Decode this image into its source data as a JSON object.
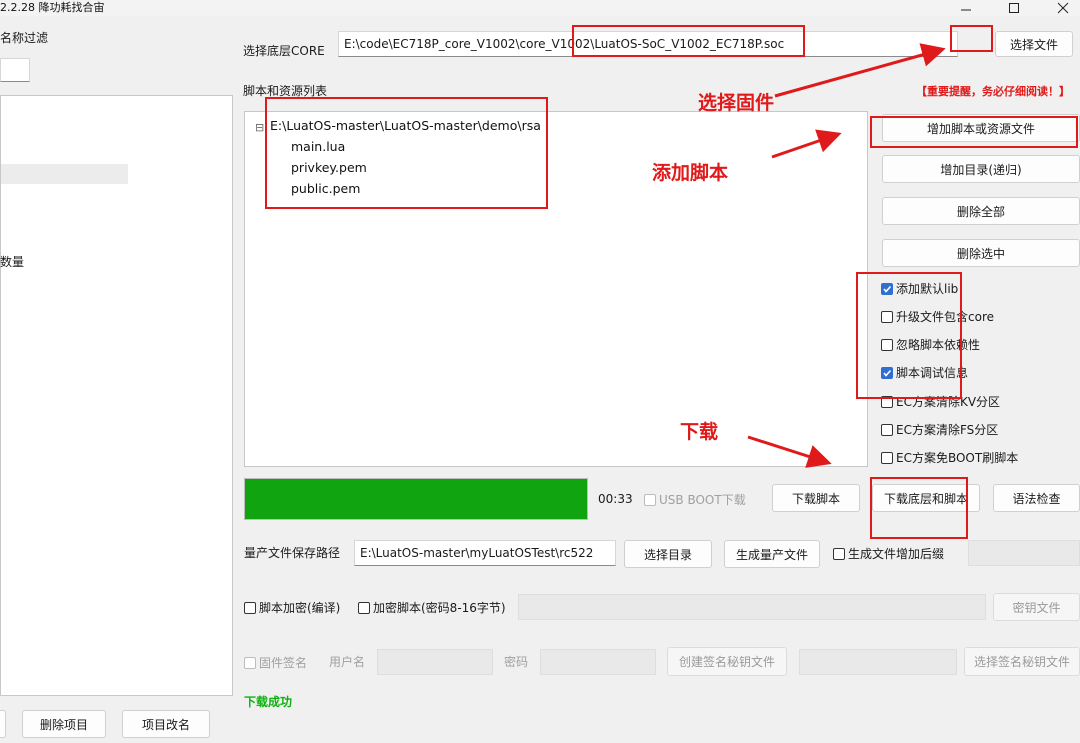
{
  "window": {
    "title": "2.2.28 降功耗找合宙",
    "minimize_icon": "minimize-icon",
    "maximize_icon": "maximize-icon",
    "close_icon": "close-icon"
  },
  "left_panel": {
    "filter_label": "名称过滤",
    "filter_value": "",
    "count_label": "数量",
    "delete_project_button": "删除项目",
    "rename_project_button": "项目改名"
  },
  "core": {
    "label": "选择底层CORE",
    "path": "E:\\code\\EC718P_core_V1002\\core_V1002\\LuatOS-SoC_V1002_EC718P.soc",
    "select_file_button": "选择文件"
  },
  "reminder_text": "【重要提醒，务必仔细阅读！】",
  "scripts": {
    "list_label": "脚本和资源列表",
    "tree_toggle": "⊟",
    "root": "E:\\LuatOS-master\\LuatOS-master\\demo\\rsa",
    "files": [
      "main.lua",
      "privkey.pem",
      "public.pem"
    ]
  },
  "side_buttons": {
    "add_script": "增加脚本或资源文件",
    "add_dir": "增加目录(递归)",
    "delete_all": "删除全部",
    "delete_selected": "删除选中"
  },
  "options": [
    {
      "label": "添加默认lib",
      "checked": true
    },
    {
      "label": "升级文件包含core",
      "checked": false
    },
    {
      "label": "忽略脚本依赖性",
      "checked": false
    },
    {
      "label": "脚本调试信息",
      "checked": true
    },
    {
      "label": "EC方案清除KV分区",
      "checked": false
    },
    {
      "label": "EC方案清除FS分区",
      "checked": false
    },
    {
      "label": "EC方案免BOOT刷脚本",
      "checked": false
    }
  ],
  "progress": {
    "fraction": 1.0,
    "color": "#10a510",
    "time": "00:33",
    "usb_boot_label": "USB BOOT下载"
  },
  "actions": {
    "download_script": "下载脚本",
    "download_core_and_script": "下载底层和脚本",
    "syntax_check": "语法检查"
  },
  "production": {
    "label": "量产文件保存路径",
    "path": "E:\\LuatOS-master\\myLuatOSTest\\rc522",
    "select_dir_button": "选择目录",
    "generate_button": "生成量产文件",
    "suffix_checkbox_label": "生成文件增加后缀"
  },
  "encryption": {
    "encrypt_compile_label": "脚本加密(编译)",
    "encrypt_password_label": "加密脚本(密码8-16字节)",
    "key_file_button": "密钥文件"
  },
  "signing": {
    "firmware_sign_label": "固件签名",
    "username_label": "用户名",
    "password_label": "密码",
    "create_key_button": "创建签名秘钥文件",
    "select_key_button": "选择签名秘钥文件"
  },
  "status_text": "下载成功",
  "annotations": {
    "select_firmware": "选择固件",
    "add_script": "添加脚本",
    "download": "下载"
  },
  "colors": {
    "annotation_red": "#e01a1a",
    "success_green": "#10b010",
    "checkbox_blue": "#2f6fd1"
  }
}
